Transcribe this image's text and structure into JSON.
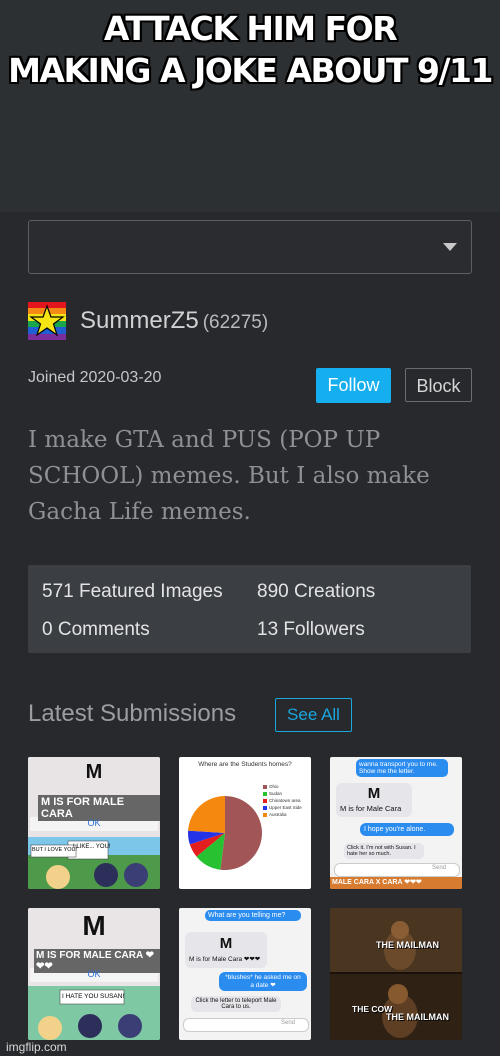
{
  "caption": {
    "line1": "ATTACK HIM FOR",
    "line2": "MAKING A JOKE ABOUT 9/11"
  },
  "profile": {
    "username": "SummerZ5",
    "points": "(62275)",
    "joined": "Joined 2020-03-20",
    "follow_label": "Follow",
    "block_label": "Block",
    "bio": "I make GTA and PUS (POP UP SCHOOL) memes. But I also make Gacha Life memes."
  },
  "stats": {
    "featured": "571 Featured Images",
    "creations": "890 Creations",
    "comments": "0 Comments",
    "followers": "13 Followers"
  },
  "latest": {
    "heading": "Latest Submissions",
    "see_all": "See All"
  },
  "thumbs": {
    "t1": {
      "letter": "M",
      "title": "M IS FOR MALE CARA",
      "ok": "OK",
      "left": "BUT I LOVE YOU!",
      "right": "I LIKE... YOU!"
    },
    "t2": {
      "title": "Where are the Students homes?",
      "legend": [
        "Ohio",
        "Sudan",
        "Chinatown area",
        "Upper East Side",
        "Australia"
      ]
    },
    "t3": {
      "top": "wanna transport you to me. Show me the letter.",
      "letter": "M",
      "body": "M is for Male Cara",
      "bubble1": "I hope you're alone.",
      "bubble2": "Click it. I'm not with Susan. I hate her so much.",
      "send": "Send",
      "footer": "MALE CARA X CARA ❤❤❤"
    },
    "t4": {
      "letter": "M",
      "title": "M IS FOR MALE CARA ❤❤❤",
      "ok": "OK",
      "bottom": "I HATE YOU SUSAN!"
    },
    "t5": {
      "top": "What are you telling me?",
      "letter": "M",
      "body": "M is for Male Cara ❤❤❤",
      "bubble1": "*blushes* he asked me on a date ❤",
      "bubble2": "Click the letter to teleport Male Cara to us.",
      "send": "Send"
    },
    "t6": {
      "l1": "THE MAILMAN",
      "l2": "THE COW",
      "l3": "THE MAILMAN"
    }
  },
  "watermark": "imgflip.com",
  "colors": {
    "accent": "#15aff0",
    "pie": [
      "#a25556",
      "#28c131",
      "#e21e1e",
      "#2433e8",
      "#f5880f"
    ]
  },
  "chart_data": {
    "type": "pie",
    "title": "Where are the Students homes?",
    "categories": [
      "Ohio",
      "Sudan",
      "Chinatown area",
      "Upper East Side",
      "Australia"
    ],
    "values": [
      52,
      12,
      6,
      6,
      24
    ]
  }
}
